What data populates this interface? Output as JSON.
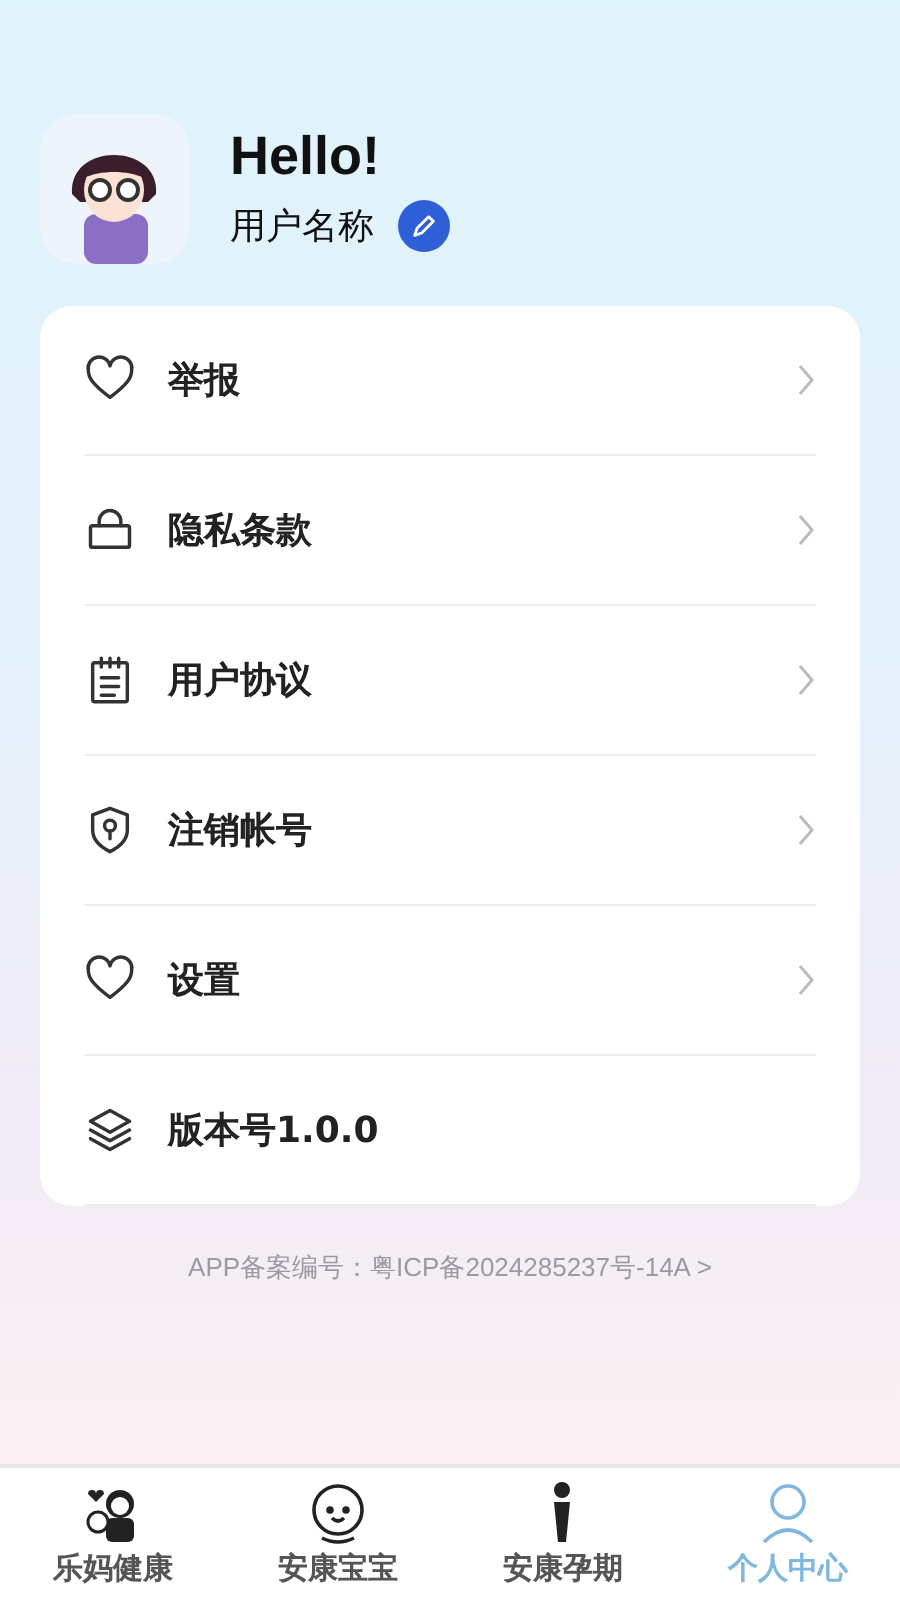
{
  "profile": {
    "greeting": "Hello!",
    "username": "用户名称"
  },
  "menu": [
    {
      "label": "举报",
      "chevron": true
    },
    {
      "label": "隐私条款",
      "chevron": true
    },
    {
      "label": "用户协议",
      "chevron": true
    },
    {
      "label": "注销帐号",
      "chevron": true
    },
    {
      "label": "设置",
      "chevron": true
    },
    {
      "label": "版本号1.0.0",
      "chevron": false
    }
  ],
  "icp": "APP备案编号：粤ICP备2024285237号-14A >",
  "tabs": [
    {
      "label": "乐妈健康",
      "selected": false
    },
    {
      "label": "安康宝宝",
      "selected": false
    },
    {
      "label": "安康孕期",
      "selected": false
    },
    {
      "label": "个人中心",
      "selected": true
    }
  ]
}
